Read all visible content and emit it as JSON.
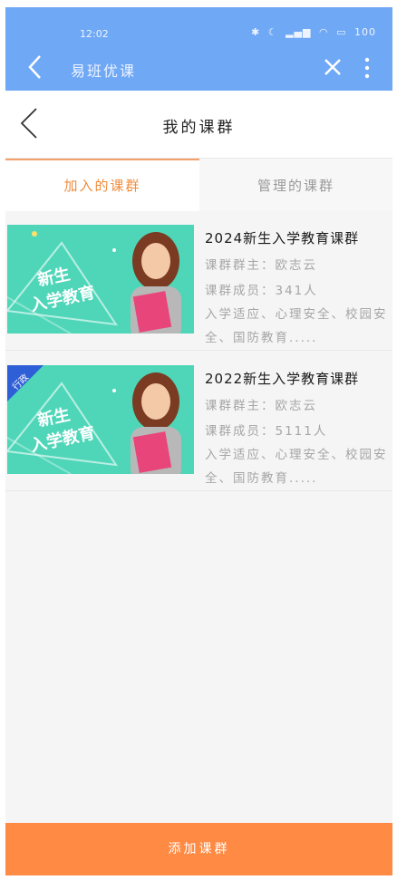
{
  "status_bar": {
    "time": "12:02",
    "icons": [
      "nfc-icon",
      "bluetooth-icon",
      "moon-icon",
      "mute-icon",
      "signal-icon",
      "signal-icon",
      "wifi-icon",
      "battery-icon"
    ],
    "battery": "100"
  },
  "app_bar": {
    "title": "易班优课"
  },
  "header": {
    "title": "我的课群"
  },
  "tabs": [
    {
      "label": "加入的课群",
      "active": true
    },
    {
      "label": "管理的课群",
      "active": false
    }
  ],
  "courses": [
    {
      "title": "2024新生入学教育课群",
      "owner": "课群群主：欧志云",
      "members": "课群成员：341人",
      "description": "入学适应、心理安全、校园安全、国防教育.....",
      "thumb_text_1": "新生",
      "thumb_text_2": "入学教育",
      "badge": ""
    },
    {
      "title": "2022新生入学教育课群",
      "owner": "课群群主：欧志云",
      "members": "课群成员：5111人",
      "description": "入学适应、心理安全、校园安全、国防教育.....",
      "thumb_text_1": "新生",
      "thumb_text_2": "入学教育",
      "badge": "行政"
    }
  ],
  "footer": {
    "add_label": "添加课群"
  },
  "colors": {
    "top_bar": "#6fa8f5",
    "accent": "#f08c3c",
    "button": "#ff8a43",
    "thumb_bg": "#4fd6b8"
  }
}
